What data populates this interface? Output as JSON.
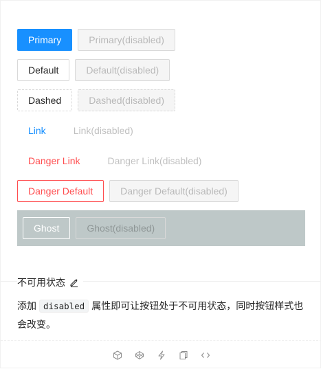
{
  "buttons": {
    "primary": "Primary",
    "primary_disabled": "Primary(disabled)",
    "default": "Default",
    "default_disabled": "Default(disabled)",
    "dashed": "Dashed",
    "dashed_disabled": "Dashed(disabled)",
    "link": "Link",
    "link_disabled": "Link(disabled)",
    "danger_link": "Danger Link",
    "danger_link_disabled": "Danger Link(disabled)",
    "danger_default": "Danger Default",
    "danger_default_disabled": "Danger Default(disabled)",
    "ghost": "Ghost",
    "ghost_disabled": "Ghost(disabled)"
  },
  "meta": {
    "title": "不可用状态",
    "desc_prefix": "添加",
    "desc_code": "disabled",
    "desc_suffix": "属性即可让按钮处于不可用状态，同时按钮样式也会改变。"
  },
  "colors": {
    "primary": "#1890ff",
    "danger": "#ff4d4f",
    "ghost_bg": "#bec8c8"
  },
  "icons": [
    "codesandbox-icon",
    "codepen-icon",
    "riddle-icon",
    "copy-icon",
    "code-icon"
  ]
}
